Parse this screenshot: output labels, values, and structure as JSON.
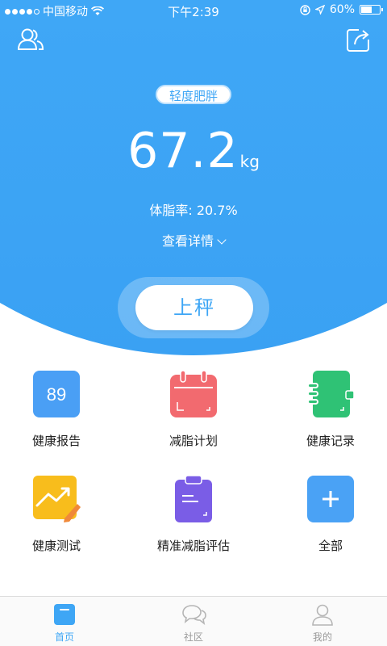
{
  "status_bar": {
    "carrier": "中国移动",
    "time": "下午2:39",
    "battery": "60%"
  },
  "header": {
    "user_icon": "users-icon",
    "share_icon": "share-icon"
  },
  "summary": {
    "status_badge": "轻度肥胖",
    "weight_value": "67.2",
    "weight_unit": "kg",
    "body_fat_label": "体脂率:",
    "body_fat_value": "20.7%",
    "details_link": "查看详情"
  },
  "weigh_button": "上秤",
  "features": [
    {
      "label": "健康报告",
      "icon": "report-89-icon",
      "icon_text": "89",
      "color": "#4a9ff5"
    },
    {
      "label": "减脂计划",
      "icon": "calendar-icon",
      "color": "#f26a6f"
    },
    {
      "label": "健康记录",
      "icon": "notebook-icon",
      "color": "#2fc275"
    },
    {
      "label": "健康测试",
      "icon": "trend-chart-icon",
      "color": "#f8bd1c"
    },
    {
      "label": "精准减脂评估",
      "icon": "clipboard-icon",
      "color": "#7a5de6"
    },
    {
      "label": "全部",
      "icon": "plus-icon",
      "color": "#4aa2f5"
    }
  ],
  "tabbar": {
    "tabs": [
      {
        "label": "首页",
        "icon": "scale-icon",
        "active": true
      },
      {
        "label": "社区",
        "icon": "chat-bubbles-icon",
        "active": false
      },
      {
        "label": "我的",
        "icon": "person-icon",
        "active": false
      }
    ]
  }
}
